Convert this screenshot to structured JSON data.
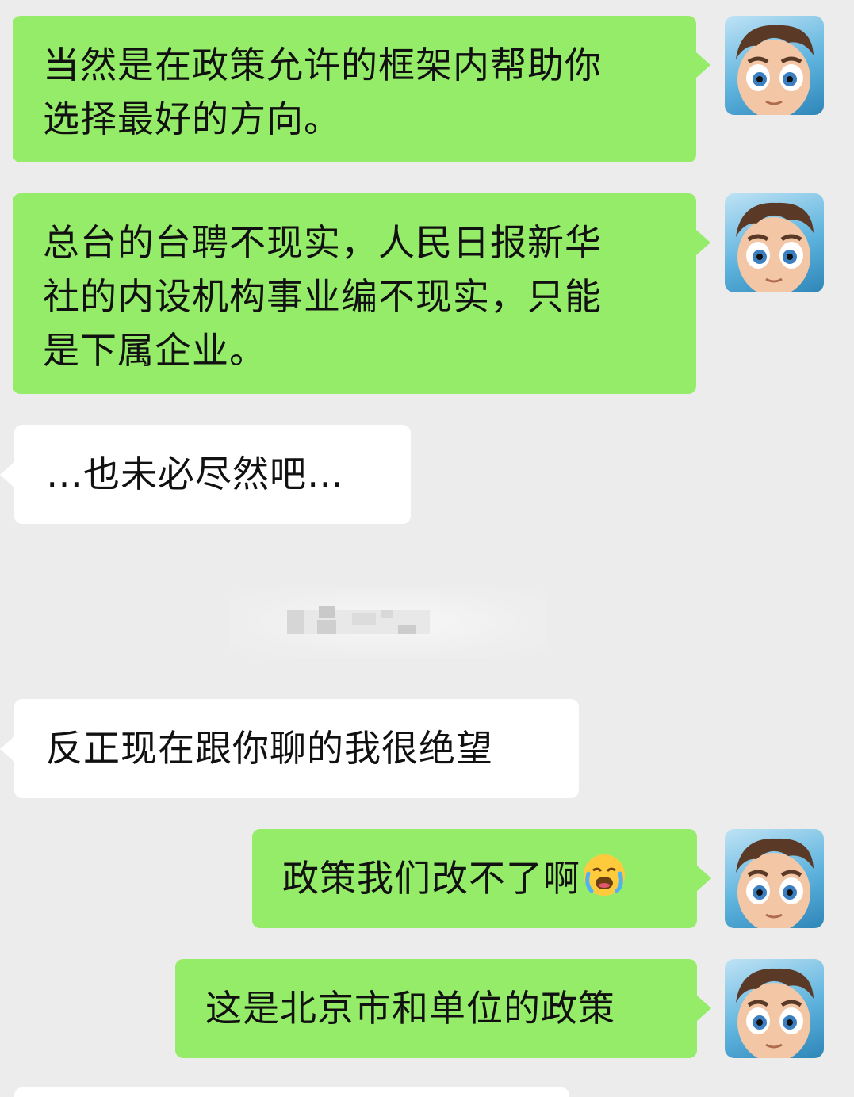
{
  "messages": [
    {
      "side": "sent",
      "text": "当然是在政策允许的框架内帮助你\n选择最好的方向。"
    },
    {
      "side": "sent",
      "text": "总台的台聘不现实，人民日报新华\n社的内设机构事业编不现实，只能\n是下属企业。"
    },
    {
      "side": "recv",
      "text": "…也未必尽然吧…"
    },
    {
      "side": "recv",
      "text": "反正现在跟你聊的我很绝望"
    },
    {
      "side": "sent",
      "text": "政策我们改不了啊",
      "emoji": "loudly-crying-face"
    },
    {
      "side": "sent",
      "text": "这是北京市和单位的政策"
    }
  ],
  "colors": {
    "background": "#ececec",
    "sent_bubble": "#95ec69",
    "received_bubble": "#ffffff",
    "text": "#111111"
  },
  "icons": {
    "avatar": "cartoon-boy-avatar-icon",
    "emoji": "loudly-crying-face-icon"
  }
}
